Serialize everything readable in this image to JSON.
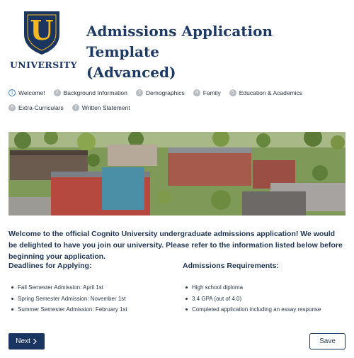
{
  "header": {
    "logo_letter": "U",
    "logo_text": "UNIVERSITY",
    "title_line1": "Admissions Application Template",
    "title_line2": "(Advanced)"
  },
  "colors": {
    "brand_navy": "#1b3561",
    "logo_gold": "#f5b81c",
    "active_step": "#3c7dc4"
  },
  "steps": [
    {
      "number": "1",
      "label": "Welcome!",
      "active": true
    },
    {
      "number": "2",
      "label": "Background Information",
      "active": false
    },
    {
      "number": "3",
      "label": "Demographics",
      "active": false
    },
    {
      "number": "4",
      "label": "Family",
      "active": false
    },
    {
      "number": "5",
      "label": "Education & Academics",
      "active": false
    },
    {
      "number": "6",
      "label": "Extra-Curriculars",
      "active": false
    },
    {
      "number": "7",
      "label": "Written Statement",
      "active": false
    }
  ],
  "hero": {
    "icon": "campus-aerial-photo"
  },
  "intro": "Welcome to the official Cognito University undergraduate admissions application! We would be delighted to have you join our university. Please refer to the information listed below before beginning your application.",
  "deadlines": {
    "title": "Deadlines for Applying:",
    "items": [
      "Fall Semester Admission: April 1st",
      "Spring Semester Admission: November 1st",
      "Summer Semester Admission: February 1st"
    ]
  },
  "requirements": {
    "title": "Admissions Requirements:",
    "items": [
      "High school diploma",
      "3.4 GPA (out of 4.0)",
      "Completed application including an essay response"
    ]
  },
  "buttons": {
    "next_label": "Next",
    "next_icon": "chevron-right-icon",
    "save_label": "Save"
  }
}
